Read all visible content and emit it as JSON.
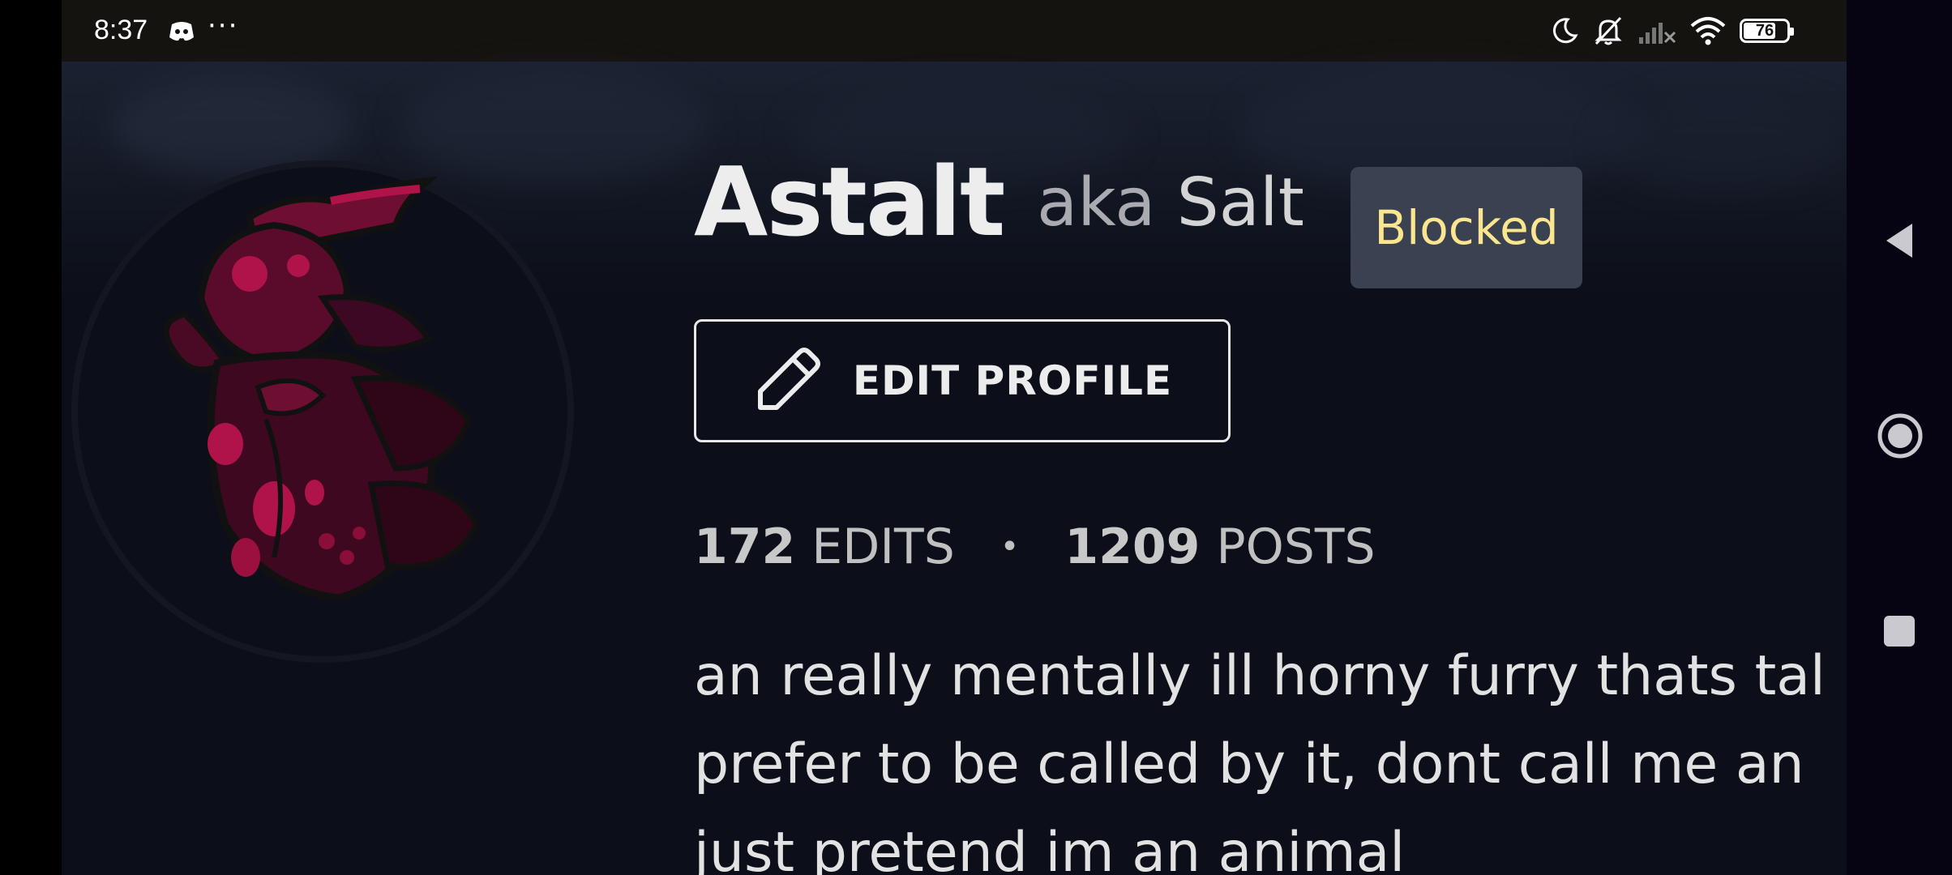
{
  "status_bar": {
    "time": "8:37",
    "more": "···",
    "battery": "76",
    "icons": [
      "discord-icon",
      "do-not-disturb-moon-icon",
      "mute-bell-icon",
      "no-signal-icon",
      "wifi-icon",
      "battery-icon"
    ]
  },
  "profile": {
    "name": "Astalt",
    "aka_label": "aka",
    "aka_name": "Salt",
    "badge": "Blocked",
    "edit_button_label": "EDIT PROFILE",
    "stats": {
      "edits_count": "172",
      "edits_label": "EDITS",
      "separator": "•",
      "posts_count": "1209",
      "posts_label": "POSTS"
    },
    "bio_lines": [
      "an really mentally ill horny furry thats tal",
      "prefer to be called by it, dont call me an",
      "just pretend im an animal"
    ]
  },
  "colors": {
    "background": "#0c0f19",
    "badge_bg": "#3a4251",
    "badge_text": "#fbe58f",
    "avatar_accent": "#b0124a"
  },
  "nav": {
    "icons": [
      "back-icon",
      "home-icon",
      "recents-icon"
    ]
  }
}
